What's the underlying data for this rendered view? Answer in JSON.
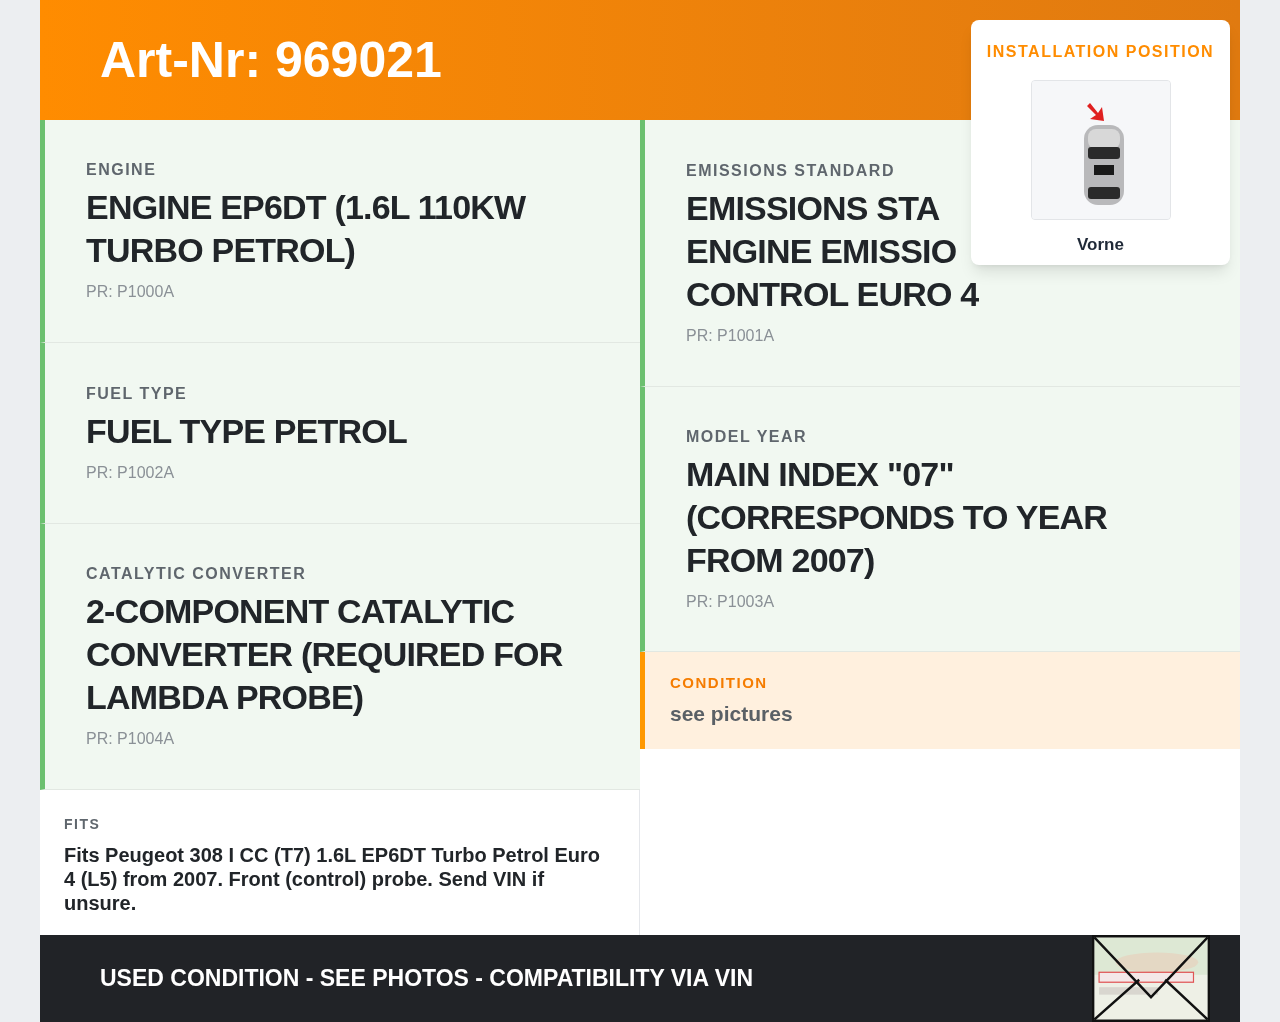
{
  "header": {
    "title": "Art-Nr: 969021"
  },
  "installation_card": {
    "title": "INSTALLATION POSITION",
    "position": "Vorne"
  },
  "left_specs": [
    {
      "label": "ENGINE",
      "value": "ENGINE EP6DT (1.6L 110KW TURBO PETROL)",
      "code": "PR: P1000A"
    },
    {
      "label": "FUEL TYPE",
      "value": "FUEL TYPE PETROL",
      "code": "PR: P1002A"
    },
    {
      "label": "CATALYTIC CONVERTER",
      "value": "2-COMPONENT CATALYTIC CONVERTER (REQUIRED FOR LAMBDA PROBE)",
      "code": "PR: P1004A"
    }
  ],
  "fits": {
    "label": "FITS",
    "text": "Fits Peugeot 308 I CC (T7) 1.6L EP6DT Turbo Petrol Euro 4 (L5) from 2007. Front (control) probe. Send VIN if unsure."
  },
  "right_specs": [
    {
      "label": "EMISSIONS STANDARD",
      "value_lines": [
        "EMISSIONS STA",
        "ENGINE EMISSIO",
        "CONTROL EURO 4"
      ],
      "code": "PR: P1001A"
    },
    {
      "label": "MODEL YEAR",
      "value_lines": [
        "MAIN INDEX \"07\"",
        "(CORRESPONDS TO YEAR",
        "FROM 2007)"
      ],
      "code": "PR: P1003A"
    }
  ],
  "condition": {
    "label": "CONDITION",
    "text": "see pictures"
  },
  "footer": {
    "text": "USED CONDITION - SEE PHOTOS - COMPATIBILITY VIA VIN"
  }
}
